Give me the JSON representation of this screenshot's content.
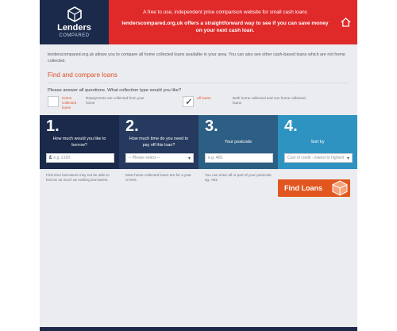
{
  "header": {
    "logo_name": "Lenders",
    "logo_sub": "COMPARED",
    "tagline": "A free to use, independent price comparison website for small cash loans",
    "headline": "lenderscompared.org.uk offers a straightforward way to see if you can save money on your next cash loan."
  },
  "intro": "lenderscompared.org.uk allows you to compare all home collected loans available in your area. You can also see other cash-based loans which are not home collected.",
  "section_title": "Find and compare loans",
  "question": "Please answer all questions. What collection type would you like?",
  "options": [
    {
      "label": "Home collected loans",
      "desc": "Repayments are collected from your home",
      "checked": false
    },
    {
      "label": "All loans",
      "desc": "Both home collected and non home collected loans",
      "checked": true
    }
  ],
  "steps": [
    {
      "num": "1.",
      "label": "How much would you like to borrow?",
      "currency": "£",
      "placeholder": "e.g. £100",
      "color": "#1b2a4a"
    },
    {
      "num": "2.",
      "label": "How much time do you need to pay off this loan?",
      "value": "-- Please select --",
      "color": "#253a5e"
    },
    {
      "num": "3.",
      "label": "Your postcode",
      "placeholder": "e.g. AB1",
      "color": "#2d5f84"
    },
    {
      "num": "4.",
      "label": "Sort by",
      "value": "Cost of credit - lowest to highest",
      "color": "#2f93c1"
    }
  ],
  "hints": [
    "First time borrowers may not be able to borrow as much as existing borrowers.",
    "Most home collected loans are for a year or less.",
    "You can enter all or part of your postcode eg. AB1"
  ],
  "find_button": "Find Loans",
  "colors": {
    "navy": "#1b2a4a",
    "banner_red": "#e02a2a",
    "accent_orange": "#e2571f",
    "step4_blue": "#2f93c1"
  }
}
